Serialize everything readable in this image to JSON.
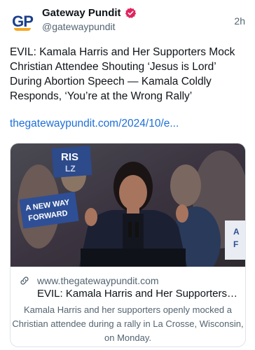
{
  "post": {
    "author": "Gateway Pundit",
    "handle": "@gatewaypundit",
    "time": "2h",
    "avatar_text": "GP",
    "text": "EVIL: Kamala Harris and Her Supporters Mock Christian Attendee Shouting ‘Jesus is Lord’ During Abortion Speech — Kamala Coldly Responds, ‘You’re at the Wrong Rally’",
    "link": "thegatewaypundit.com/2024/10/e..."
  },
  "card": {
    "domain": "www.thegatewaypundit.com",
    "title": "EVIL: Kamala Harris and Her Supporters Mock",
    "description": "Kamala Harris and her supporters openly mocked a Christian attendee during a rally in La Crosse, Wisconsin, on Monday.",
    "image_signs": [
      "RIS",
      "LZ",
      "A NEW WAY",
      "FORWARD"
    ],
    "image_sign_right": "A",
    "image_sign_right2": "F"
  },
  "colors": {
    "accent_link": "#1d6fd8",
    "verified": "#e0245e",
    "gp_blue": "#1b3f8b",
    "gp_orange": "#f5a623"
  },
  "icons": [
    "verified-badge-icon",
    "link-icon"
  ]
}
